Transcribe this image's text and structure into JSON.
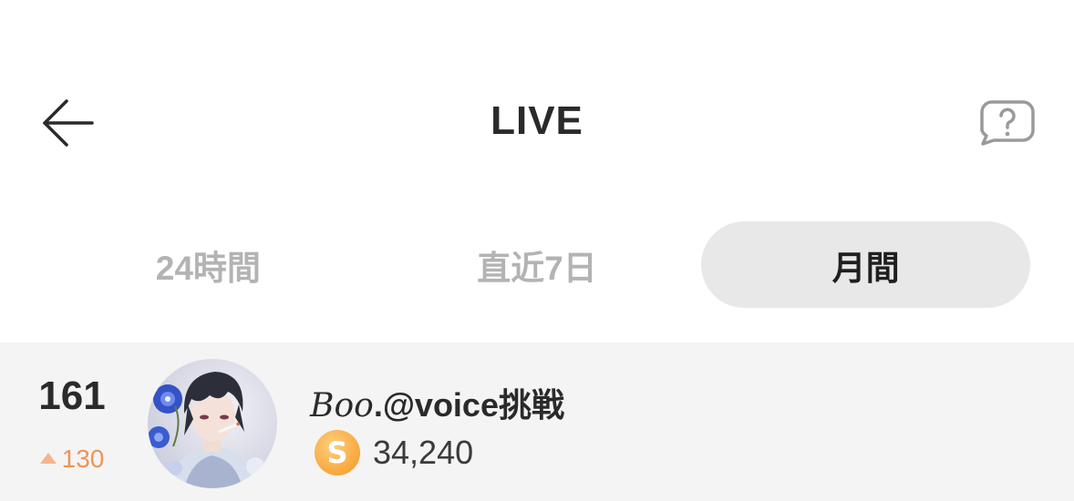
{
  "header": {
    "title": "LIVE",
    "back_icon": "arrow-left-icon",
    "help_icon": "question-bubble-icon"
  },
  "tabs": [
    {
      "label": "24時間",
      "active": false
    },
    {
      "label": "直近7日",
      "active": false
    },
    {
      "label": "月間",
      "active": true
    }
  ],
  "ranking": [
    {
      "rank": "161",
      "change": "130",
      "change_direction": "up",
      "name_script": "Boo",
      "name_rest": ".@voice挑戦",
      "coin_icon": "coin-s-icon",
      "coin_letter": "S",
      "coins": "34,240"
    }
  ],
  "colors": {
    "active_tab_bg": "#e8e8e8",
    "inactive_tab_text": "#b3b3b3",
    "row_bg": "#f4f4f4",
    "rank_up": "#ee9455",
    "coin": "#f7a73b"
  }
}
